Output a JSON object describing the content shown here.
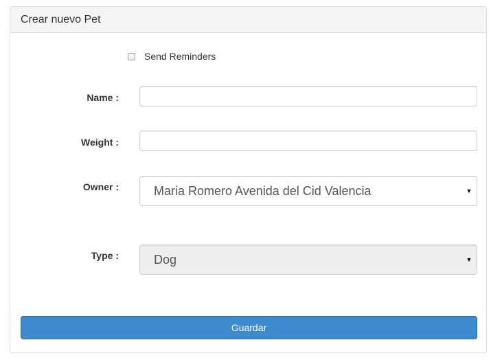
{
  "panel": {
    "title": "Crear nuevo Pet"
  },
  "form": {
    "send_reminders": {
      "label": "Send Reminders",
      "checked": false
    },
    "name": {
      "label": "Name :",
      "value": ""
    },
    "weight": {
      "label": "Weight :",
      "value": ""
    },
    "owner": {
      "label": "Owner :",
      "selected": "Maria Romero Avenida del Cid Valencia"
    },
    "type": {
      "label": "Type :",
      "selected": "Dog",
      "disabled": true
    },
    "submit_label": "Guardar"
  },
  "icons": {
    "select_caret": "▼"
  },
  "colors": {
    "primary_button": "#3e8ace",
    "panel_heading_bg": "#f5f5f5",
    "disabled_select_bg": "#eeeeee"
  }
}
